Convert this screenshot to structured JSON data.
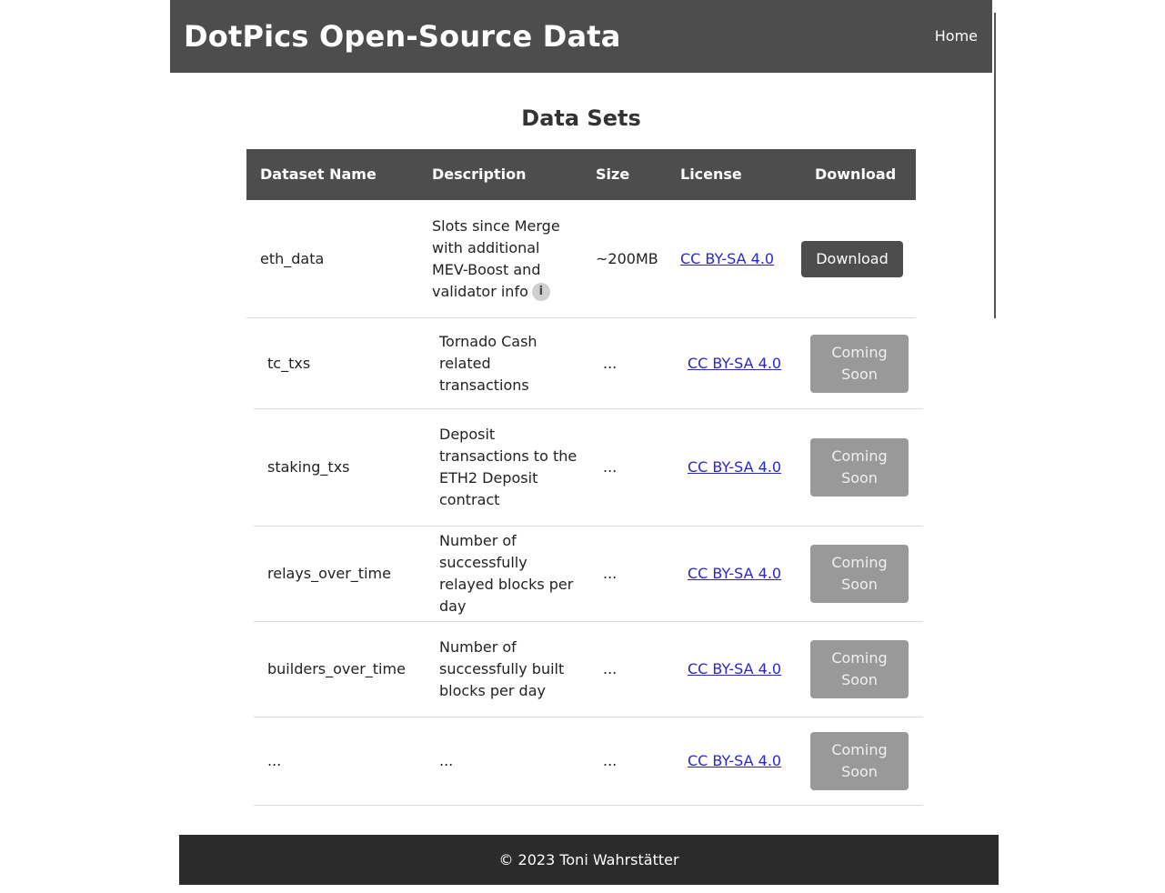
{
  "header": {
    "site_title": "DotPics Open-Source Data",
    "nav": {
      "home": "Home"
    }
  },
  "main": {
    "title": "Data Sets",
    "columns": [
      "Dataset Name",
      "Description",
      "Size",
      "License",
      "Download"
    ],
    "rows": [
      {
        "name": "eth_data",
        "description": "Slots since Merge with additional MEV-Boost and validator info",
        "info_icon": "i",
        "size": "~200MB",
        "license": "CC BY-SA 4.0",
        "action": "Download"
      },
      {
        "name": "tc_txs",
        "description": "Tornado Cash related transactions",
        "size": "...",
        "license": "CC BY-SA 4.0",
        "action": "Coming Soon"
      },
      {
        "name": "staking_txs",
        "description": "Deposit transactions to the ETH2 Deposit contract",
        "size": "...",
        "license": "CC BY-SA 4.0",
        "action": "Coming Soon"
      },
      {
        "name": "relays_over_time",
        "description": "Number of successfully relayed blocks per day",
        "size": "...",
        "license": "CC BY-SA 4.0",
        "action": "Coming Soon"
      },
      {
        "name": "builders_over_time",
        "description": "Number of successfully built blocks per day",
        "size": "...",
        "license": "CC BY-SA 4.0",
        "action": "Coming Soon"
      },
      {
        "name": "...",
        "description": "...",
        "size": "...",
        "license": "CC BY-SA 4.0",
        "action": "Coming Soon"
      }
    ]
  },
  "footer": {
    "copyright": "© 2023 Toni Wahrstätter"
  },
  "colors": {
    "header_bg": "#4d4d4d",
    "footer_bg": "#2b2b2b",
    "button_primary": "#4d4d4d",
    "button_disabled": "#999999",
    "link": "#2a24d6"
  }
}
